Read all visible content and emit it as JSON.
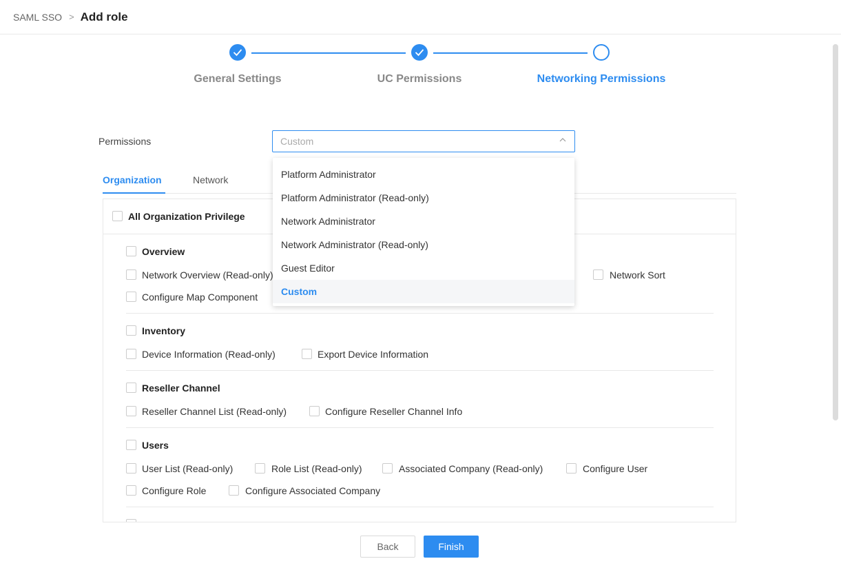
{
  "breadcrumb": {
    "parent": "SAML SSO",
    "separator": ">",
    "current": "Add role"
  },
  "steps": [
    {
      "label": "General Settings",
      "state": "done"
    },
    {
      "label": "UC Permissions",
      "state": "done"
    },
    {
      "label": "Networking Permissions",
      "state": "active"
    }
  ],
  "permissions": {
    "label": "Permissions",
    "placeholder": "Custom",
    "options": [
      "Platform Administrator",
      "Platform Administrator (Read-only)",
      "Network Administrator",
      "Network Administrator (Read-only)",
      "Guest Editor",
      "Custom"
    ],
    "selected": "Custom"
  },
  "tabs": [
    "Organization",
    "Network"
  ],
  "all_privilege": "All Organization Privilege",
  "groups": {
    "overview": {
      "title": "Overview",
      "items": [
        "Network Overview (Read-only)",
        "Network Sort",
        "Configure Map Component"
      ]
    },
    "inventory": {
      "title": "Inventory",
      "items": [
        "Device Information (Read-only)",
        "Export Device Information"
      ]
    },
    "reseller": {
      "title": "Reseller Channel",
      "items": [
        "Reseller Channel List (Read-only)",
        "Configure Reseller Channel Info"
      ]
    },
    "users": {
      "title": "Users",
      "items": [
        "User List (Read-only)",
        "Role List (Read-only)",
        "Associated Company (Read-only)",
        "Configure User",
        "Configure Role",
        "Configure Associated Company"
      ]
    }
  },
  "buttons": {
    "back": "Back",
    "finish": "Finish"
  },
  "colors": {
    "accent": "#2d8cf0"
  }
}
